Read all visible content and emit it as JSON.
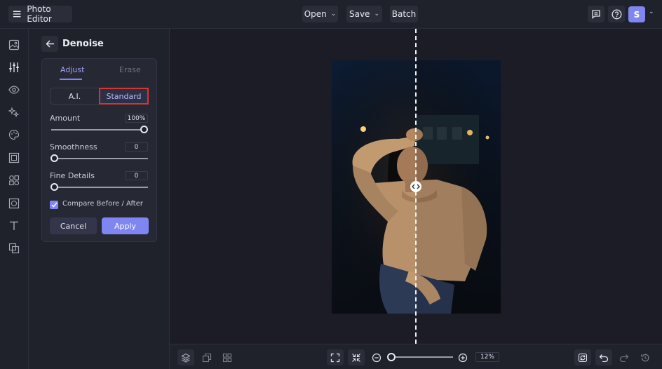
{
  "header": {
    "app_title": "Photo Editor",
    "menu": {
      "open": "Open",
      "save": "Save",
      "batch": "Batch"
    },
    "avatar_letter": "S"
  },
  "panel": {
    "title": "Denoise",
    "tabs": [
      "Adjust",
      "Erase"
    ],
    "active_tab": "Adjust",
    "modes": {
      "ai": "A.I.",
      "standard": "Standard"
    },
    "selected_mode": "Standard",
    "sliders": {
      "amount": {
        "label": "Amount",
        "value": "100%",
        "level": 1.0
      },
      "smoothness": {
        "label": "Smoothness",
        "value": "0",
        "level": 0.0
      },
      "fine_details": {
        "label": "Fine Details",
        "value": "0",
        "level": 0.0
      }
    },
    "compare": {
      "label": "Compare Before / After",
      "checked": true
    },
    "buttons": {
      "cancel": "Cancel",
      "apply": "Apply"
    }
  },
  "bottom": {
    "zoom": "12%",
    "zoom_level": 0.0
  },
  "colors": {
    "accent": "#7f86f2",
    "highlight": "#d33535",
    "background": "#1b1c26"
  }
}
